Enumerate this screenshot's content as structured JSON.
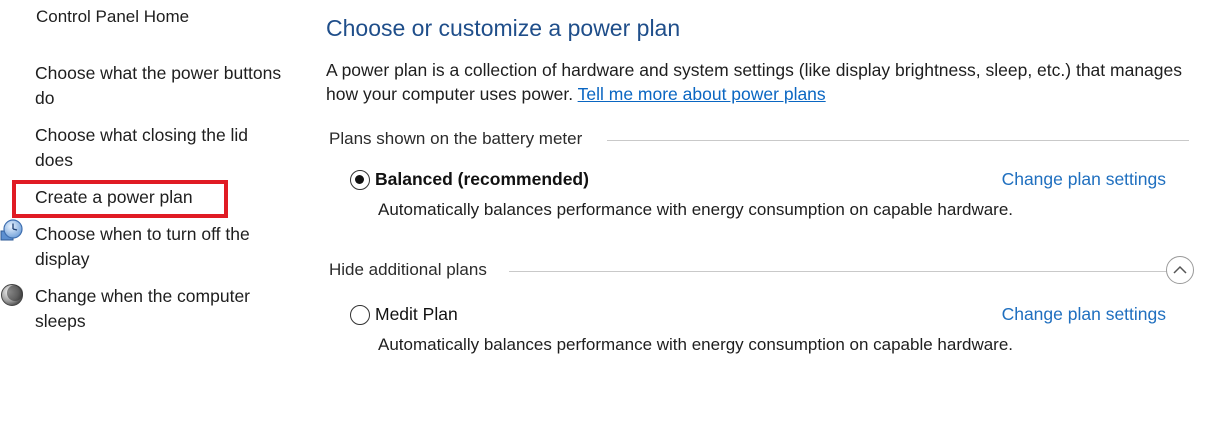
{
  "sidebar": {
    "home_label": "Control Panel Home",
    "items": [
      {
        "label": "Choose what the power buttons do"
      },
      {
        "label": "Choose what closing the lid does"
      },
      {
        "label": "Create a power plan"
      },
      {
        "label": "Choose when to turn off the display",
        "icon": "display-clock-icon"
      },
      {
        "label": "Change when the computer sleeps",
        "icon": "moon-sleep-icon"
      }
    ],
    "highlight_color": "#e01b24"
  },
  "main": {
    "title": "Choose or customize a power plan",
    "intro_text": "A power plan is a collection of hardware and system settings (like display brightness, sleep, etc.) that manages how your computer uses power. ",
    "intro_link": "Tell me more about power plans",
    "battery_group": {
      "header": "Plans shown on the battery meter",
      "plans": [
        {
          "name": "Balanced (recommended)",
          "selected": true,
          "change_label": "Change plan settings",
          "description": "Automatically balances performance with energy consumption on capable hardware."
        }
      ]
    },
    "additional_group": {
      "header": "Hide additional plans",
      "collapse_icon": "chevron-up-icon",
      "plans": [
        {
          "name": "Medit Plan",
          "selected": false,
          "change_label": "Change plan settings",
          "description": "Automatically balances performance with energy consumption on capable hardware."
        }
      ]
    },
    "colors": {
      "title": "#1f4e8a",
      "link": "#1f6fbf"
    }
  }
}
